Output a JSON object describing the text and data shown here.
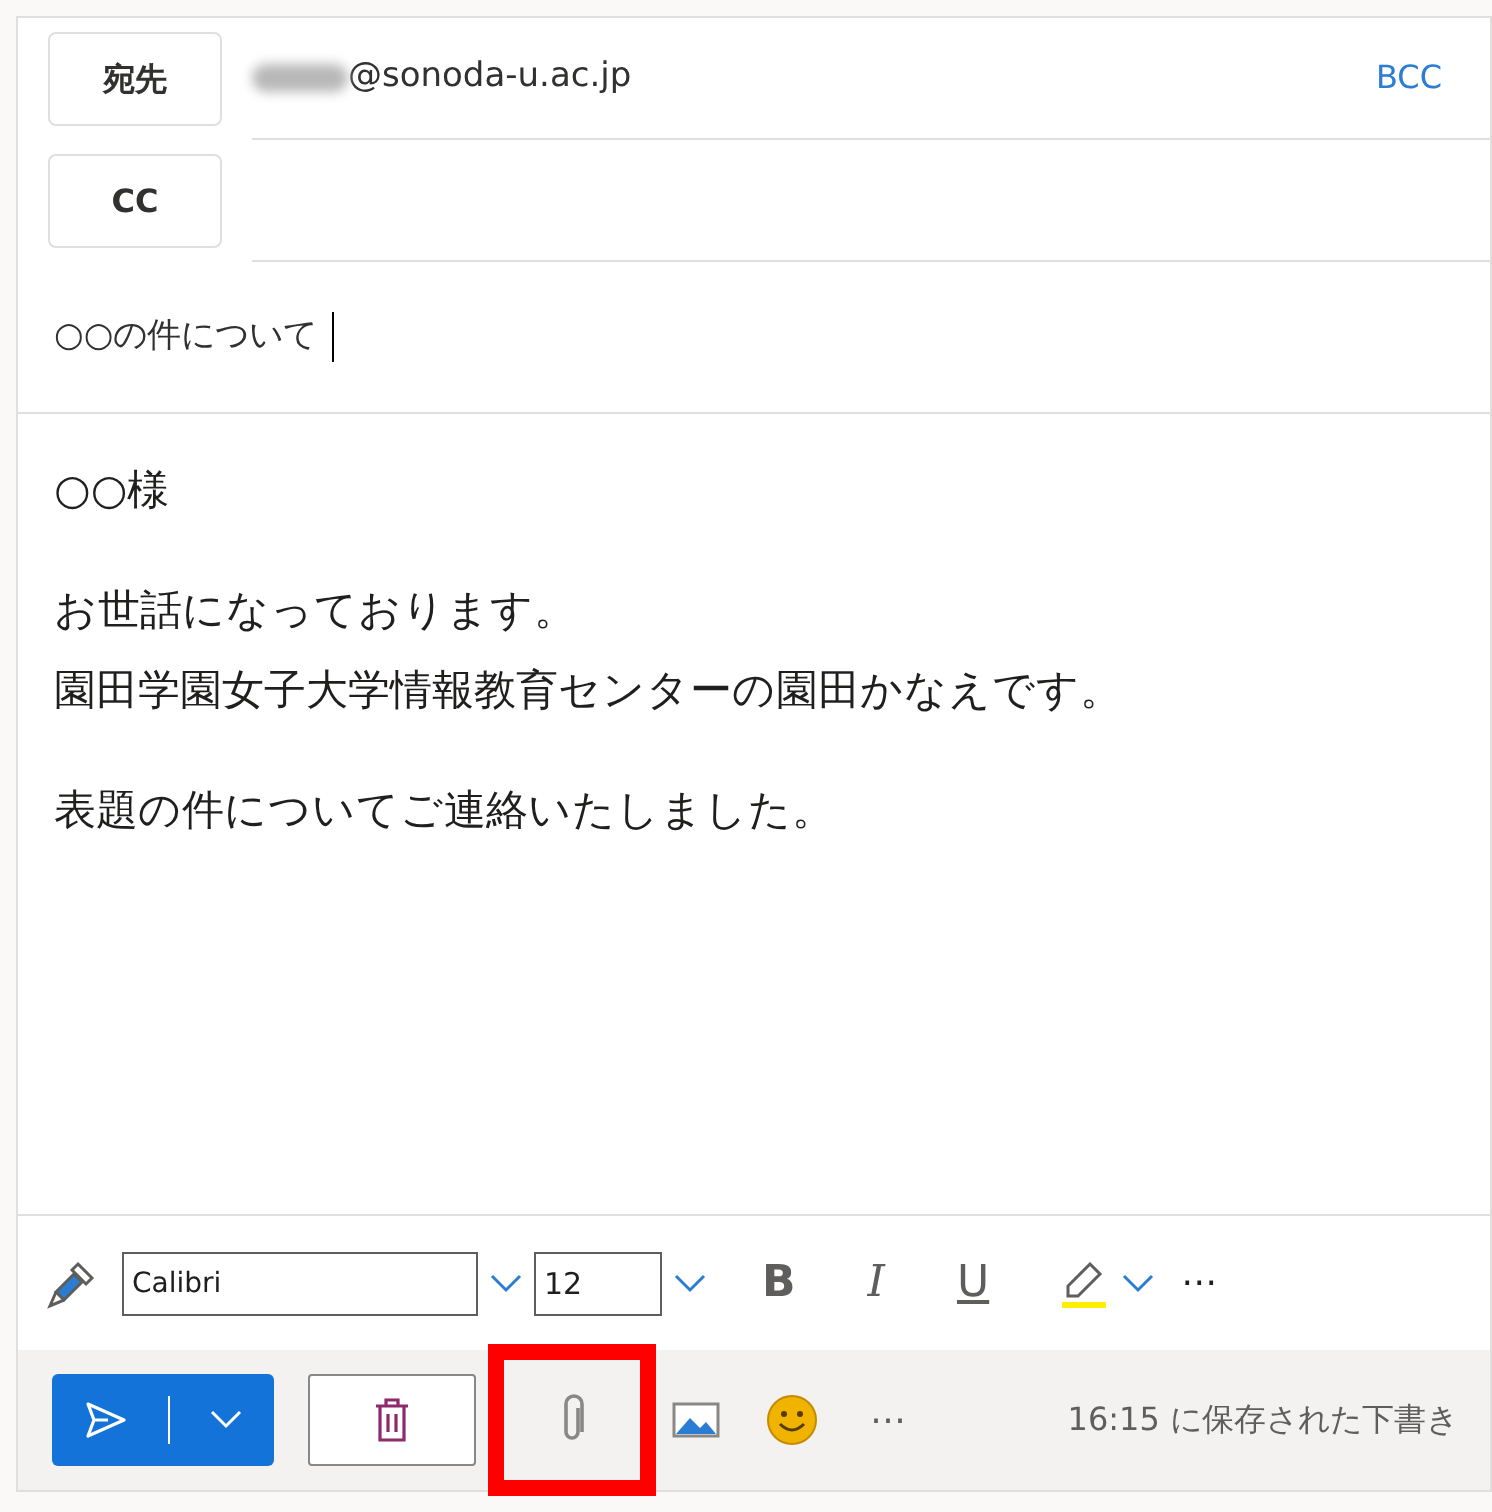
{
  "recipients": [
    {
      "label": "宛先",
      "address": "@sonoda-u.ac.jp",
      "redacted": true
    },
    {
      "label": "CC",
      "redacted": false
    }
  ],
  "bcc_link": "BCC",
  "subject": {
    "value": "○○の件について",
    "caret": true
  },
  "body": {
    "paragraphs": [
      [
        "○○様"
      ],
      [
        "お世話になっております。",
        "園田学園女子大学情報教育センターの園田かなえです。"
      ],
      [
        "表題の件についてご連絡いたしました。"
      ]
    ]
  },
  "format_toolbar": {
    "font": "Calibri",
    "size": "12",
    "bold": "B",
    "italic": "I",
    "underline": "U",
    "overflow": "⋯"
  },
  "actions": [
    {
      "kind": "send",
      "highlighted": false
    },
    {
      "kind": "discard",
      "highlighted": false
    },
    {
      "kind": "attach",
      "highlighted": true
    },
    {
      "kind": "image",
      "highlighted": false
    },
    {
      "kind": "emoji",
      "highlighted": false
    },
    {
      "kind": "more",
      "label": "⋯",
      "highlighted": false
    }
  ],
  "status": "16:15 に保存された下書き"
}
